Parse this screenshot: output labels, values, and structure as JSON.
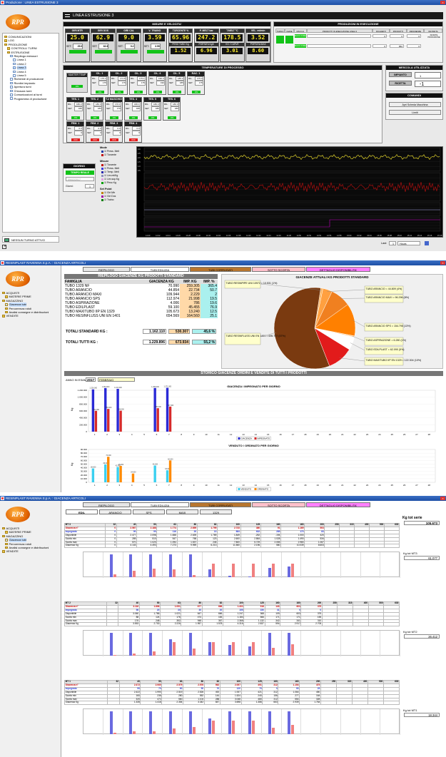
{
  "colors": {
    "accent": "#e06000",
    "seg_text": "#ffef2e",
    "ok": "#12c318",
    "alarm": "#e21b1b",
    "pie_brown": "#7a3a10"
  },
  "win1": {
    "title": "Produzione : LINEA ESTRUSIONE 3",
    "logo": "RPR",
    "header_title": "LINEA ESTRUSIONE 3",
    "tree": [
      "COMUNICAZIONI",
      "LOG",
      "PRODUZIONE",
      "CONTROLLI TURNI",
      "ESTRUSIONE",
      "Riepilogo estrusori",
      "Linea 1",
      "Linea 2",
      "Linea 3",
      "Linea 4",
      "Linea 5",
      "Richieste di produzione",
      "Riordini impianto",
      "Apertura turni",
      "Chiusura turni",
      "Comunicazioni ai turni",
      "Programma di produzione"
    ],
    "status_button": "NESSUN TURNO ATTIVO",
    "measures": {
      "title": "MISURE E VELOCITA'",
      "items": [
        {
          "label": "GIRI MTR",
          "value": "25.0",
          "set": "25.0"
        },
        {
          "label": "GIRI DOS",
          "value": "62.9",
          "set": "62.6"
        },
        {
          "label": "GIRI CAL",
          "value": "9.0",
          "set": "9.2"
        },
        {
          "label": "V. TRAINO",
          "value": "3.59",
          "set": "3.59"
        },
        {
          "label": "TORCENTE %",
          "value": "65.96",
          "extra": "PESO TUBO Kg",
          "extra_val": "1.52"
        },
        {
          "label": "P. MELT bar",
          "value": "247.2",
          "extra": "PORTATA Kg/h",
          "extra_val": "6.96"
        },
        {
          "label": "T.MELT °C",
          "value": "178.5",
          "extra": "KG / CURVE",
          "extra_val": "3.01"
        },
        {
          "label": "VEL. mt/min",
          "value": "3.52",
          "extra": "PORTATA MAX",
          "extra_val": "8.60"
        }
      ],
      "set_label": "SET:"
    },
    "production": {
      "title": "PRODUZIONI IN ESECUZIONE",
      "headers": [
        "TURNO",
        "FERIE",
        "MACCH.",
        "PRODOTTI IN ESECUZIONE LINEA 3",
        "RICHIESTI",
        "PRODOTTI",
        "RIMANENZE",
        "INFISSITA"
      ],
      "rows": [
        {
          "code": "MACC.3 DRE",
          "req": "0",
          "prod": "0",
          "rem": "0",
          "inf": "INFINITE PRODUZIONE"
        },
        {
          "code": "MACC.3 DRE",
          "req": "0",
          "prod": "862",
          "rem": "0",
          "inf": ""
        }
      ]
    },
    "temps": {
      "title": "TEMPERATURE DI PROCESSO",
      "master": "MASTER TEMP",
      "zones": [
        {
          "name": "CIL. 1",
          "ril": "175.4",
          "set": "175"
        },
        {
          "name": "CIL. 2",
          "ril": "174.8",
          "set": "175"
        },
        {
          "name": "CIL. 3",
          "ril": "175.1",
          "set": "175"
        },
        {
          "name": "CIL. 4",
          "ril": "190.3",
          "set": "190"
        },
        {
          "name": "CIL. 5",
          "ril": "185.2",
          "set": "185"
        },
        {
          "name": "RAC. 1",
          "ril": "175.0",
          "set": "175"
        },
        {
          "name": "TES. 1",
          "ril": "180.2",
          "set": "180"
        },
        {
          "name": "TES. 2",
          "ril": "180.0",
          "set": "180"
        },
        {
          "name": "T.2 MASCHIO",
          "ril": "170.1",
          "set": "170"
        },
        {
          "name": "TES. 4",
          "ril": "180.1",
          "set": "180"
        },
        {
          "name": "TES. 5",
          "ril": "180.4",
          "set": "180"
        },
        {
          "name": "TES. 6",
          "ril": "180.0",
          "set": "180"
        },
        {
          "name": "FEM. 1",
          "ril": "0.0",
          "set": "0"
        },
        {
          "name": "FEM. 2",
          "ril": "0.0",
          "set": "0"
        },
        {
          "name": "FEM. 3",
          "ril": "0.0",
          "set": "0"
        },
        {
          "name": "FEM. 4",
          "ril": "0.0",
          "set": "0"
        }
      ],
      "ril_label": "RIL.",
      "set_label": "SET",
      "on": "ON",
      "off": "OFF"
    },
    "mix": {
      "title": "MESCOLA UTILIZZATA",
      "rows": [
        {
          "label": "IMPIANTO",
          "val": "1"
        },
        {
          "label": "RICETTA",
          "val": "-1"
        }
      ]
    },
    "commands": {
      "title": "COMANDI",
      "buttons": [
        "Apri Scheda Macchina",
        "Limiti"
      ]
    },
    "day": {
      "title": "GIORNO",
      "realtime": "TEMPO REALE",
      "date": "09/02/2017",
      "shifts_label": "Giorni:",
      "shifts": "1"
    },
    "legend": {
      "modes": "Mode",
      "modes_items": [
        "Press. Melt",
        "Torcente"
      ],
      "measures": "Misure",
      "measures_items": [
        "Torcente",
        "Press. Melt",
        "Temp. Melt",
        "Lim.mt/Kg",
        "Lim.sup.Kg",
        "Peso Kg"
      ],
      "setpoint": "Set Point",
      "setpoint_items": [
        "Giri Mtr",
        "Giri Dos",
        "Traino"
      ]
    },
    "trend": {
      "ylabels_top": [
        "3.0",
        "2.5",
        "2.0",
        "1.5",
        "1.0",
        "0.5"
      ],
      "xlabels": [
        "14:20",
        "14:22",
        "14:24",
        "14:26",
        "14:28",
        "14:30",
        "14:32",
        "14:34",
        "14:36",
        "14:38",
        "14:40",
        "14:42",
        "14:44",
        "14:46",
        "14:48",
        "14:50",
        "14:52",
        "14:54",
        "14:56",
        "14:58",
        "15:00",
        "15:02",
        "15:04",
        "15:06",
        "15:08",
        "15:10",
        "15:12",
        "15:14",
        "15:16",
        "15:18"
      ],
      "last_label": "Last:",
      "last_val": "1",
      "last_unit": "Hours"
    }
  },
  "win2": {
    "title": "RESINPLAST RAVENNA S.p.A. : GIACENZA ARTICOLI",
    "logo": "RPR",
    "tree": [
      "ACQUISTI",
      "MATERIE PRIME",
      "MAGAZZINO",
      "Giacenza tubi",
      "Percorrenza rotoli",
      "Analisi consegne e distribuzioni",
      "VENDITE"
    ],
    "tabs": [
      "RIEPILOGO",
      "TUBI EDILIZIA",
      "TUBI CORRUGATI",
      "SOTTO SCORTA",
      "DETTAGLIO DISPONIBILITA'"
    ],
    "summary": {
      "title": "RIEPILOGO GIACENZE KG PRODOTTI STANDARD",
      "headers": [
        "FAMIGLIA",
        "GIACENZA KG",
        "IMP. KG",
        "IMP. %"
      ],
      "rows": [
        [
          "TUBO 1329 NF",
          "70.990",
          "259.305",
          "365.4"
        ],
        [
          "TUBO ARANCIO",
          "44.854",
          "22.734",
          "50.7"
        ],
        [
          "TUBO ARANCIO MAXI",
          "109.944",
          "2.229",
          "2"
        ],
        [
          "TUBO ARANCIO SPS",
          "112.974",
          "21.998",
          "19.5"
        ],
        [
          "TUBO ASPIRAZIONE",
          "4.006",
          "786",
          "19.6"
        ],
        [
          "TUBO EDILPLAST",
          "59.100",
          "45.455",
          "76.9"
        ],
        [
          "TUBO MAXITUBO IIP EN 1329",
          "105.673",
          "13.240",
          "12.5"
        ],
        [
          "TUBO RESINFLUSS UNI EN 1401",
          "654.569",
          "164.560",
          "25.1"
        ]
      ],
      "total_std_label": "TOTALI STANDARD KG :",
      "total_std": [
        "1.162.110",
        "530.307",
        "45,6 %"
      ],
      "total_all_label": "TOTALI TUTTI KG :",
      "total_all": [
        "1.229.896",
        "673.934",
        "55,2 %"
      ]
    },
    "pie_title": "GIACENZE ATTUALI KG PRODOTTI STANDARD",
    "pie_labels": [
      "TUBO RESINPIPE UNI 10972 = 10.531 (1%)",
      "TUBO ARANCIO = 44.809 (4%)",
      "TUBO ARANCIO MAXI = 96.296 (8%)",
      "TUBO ARANCIO SPS = 154.795 (13%)",
      "TUBO ASPIRAZIONE = 6.280 (1%)",
      "TUBO EDILPLAST = 62.090 (5%)",
      "TUBO MAXITUBO IIP EN 1329 = 122.304 (10%)",
      "TUBO RESINFLUSS UNI EN 1401 = 695.767 (57%)"
    ],
    "history": {
      "title": "STORICO GIACENZE ORDINI E VENDITE DI TUTTI I PRODOTTI",
      "year_label": "ANNO IN ESAME",
      "year": "2017",
      "month": "FEBBRAIO"
    }
  },
  "win3": {
    "title": "RESINPLAST RAVENNA S.p.A. : GIACENZA ARTICOLI",
    "logo": "RPR",
    "tree": [
      "ACQUISTI",
      "MATERIE PRIME",
      "MAGAZZINO",
      "Giacenza tubi",
      "Percorrenza rotoli",
      "Analisi consegne e distribuzioni",
      "VENDITE"
    ],
    "tabs": [
      "RIEPILOGO",
      "TUBI EDILIZIA",
      "TUBI CORRUGATI",
      "SOTTO SCORTA",
      "DETTAGLIO DISPONIBILITA'"
    ],
    "subtabs": [
      "EDIL",
      "ARANCIO",
      "SPS",
      "MAXI",
      "1329"
    ],
    "kg_tot_label": "Kg tot serie",
    "kg_tot": "105.673",
    "grids": [
      {
        "title": "MT 3",
        "diam": [
          "32",
          "40",
          "50",
          "63",
          "80",
          "82",
          "100",
          "125",
          "160",
          "160",
          "200",
          "250",
          "315",
          "400",
          "500",
          "630"
        ],
        "rows": [
          [
            "Giacenza n°",
            "0",
            "2.567",
            "2.188",
            "1.774",
            "2.659",
            "1.799",
            "2.733",
            "380",
            "91",
            "1.169",
            "503"
          ],
          [
            "Impegnato",
            "0",
            "90",
            "90",
            "116",
            "20",
            "10",
            "884",
            "632",
            "285",
            "170",
            "83"
          ],
          [
            "Disponibile",
            "0",
            "2.477",
            "2.098",
            "1.658",
            "2.639",
            "1.789",
            "1.849",
            "-252",
            "-194",
            "1.000",
            "420"
          ],
          [
            "Scorta min",
            "0",
            "285",
            "510",
            "547",
            "768",
            "123",
            "2.600",
            "2.864",
            "1.028",
            "1.490",
            "534"
          ],
          [
            "Scorta max",
            "0",
            "570",
            "1.020",
            "1.094",
            "1.537",
            "245",
            "7.800",
            "5.729",
            "2.055",
            "2.980",
            "1.067"
          ],
          [
            "Giacenza Kg",
            "0",
            "4.143",
            "4.493",
            "7.273",
            "9.959",
            "6.213",
            "11.560",
            "2.196",
            "580",
            "10.039",
            "8.603"
          ]
        ],
        "kg_label": "Kg tot MT3",
        "kg": "61.077"
      },
      {
        "title": "MT 2",
        "diam": [
          "32",
          "40",
          "50",
          "63",
          "80",
          "82",
          "100",
          "125",
          "160",
          "160",
          "200",
          "250",
          "315",
          "400",
          "500",
          "630"
        ],
        "rows": [
          [
            "Giacenza n°",
            "",
            "3.116",
            "1.806",
            "1.051",
            "677",
            "686",
            "1.402",
            "518",
            "140",
            "603",
            "375"
          ],
          [
            "Impegnato",
            "",
            "56",
            "20",
            "30",
            "30",
            "20",
            "155",
            "150",
            "31",
            "0",
            "0"
          ],
          [
            "Disponibile",
            "",
            "3.060",
            "1.786",
            "1.021",
            "647",
            "666",
            "1.247",
            "368",
            "109",
            "603",
            "375"
          ],
          [
            "Scorta min",
            "",
            "88",
            "124",
            "176",
            "474",
            "183",
            "1.184",
            "566",
            "171",
            "171",
            "155"
          ],
          [
            "Scorta max",
            "",
            "176",
            "248",
            "352",
            "948",
            "367",
            "2.368",
            "1.132",
            "342",
            "341",
            "310"
          ],
          [
            "Giacenza Kg",
            "",
            "3.553",
            "2.730",
            "2.226",
            "1.957",
            "1.578",
            "4.316",
            "2.837",
            "594",
            "2.917",
            "2.705"
          ]
        ],
        "kg_label": "Kg tot MT2",
        "kg": "26.412"
      },
      {
        "title": "MT 1",
        "diam": [
          "32",
          "40",
          "50",
          "63",
          "80",
          "82",
          "100",
          "125",
          "160",
          "160",
          "200",
          "250",
          "315",
          "400",
          "500",
          "630"
        ],
        "rows": [
          [
            "Giacenza n°",
            "",
            "2.472",
            "2.060",
            "2.579",
            "2.576",
            "562",
            "2.057",
            "491",
            "312",
            "1.154",
            "475"
          ],
          [
            "Impegnato",
            "",
            "50",
            "70",
            "60",
            "50",
            "70",
            "120",
            "70",
            "0",
            "90",
            "25"
          ],
          [
            "Disponibile",
            "",
            "2.422",
            "1.990",
            "2.519",
            "2.526",
            "492",
            "1.937",
            "421",
            "312",
            "1.064",
            "450"
          ],
          [
            "Scorta min",
            "",
            "160",
            "236",
            "280",
            "552",
            "144",
            "1.524",
            "240",
            "156",
            "277",
            "164"
          ],
          [
            "Scorta max",
            "",
            "320",
            "472",
            "560",
            "1.104",
            "288",
            "3.048",
            "480",
            "312",
            "554",
            "328"
          ],
          [
            "Giacenza Kg",
            "",
            "1.335",
            "1.418",
            "2.354",
            "3.342",
            "847",
            "3.698",
            "1.386",
            "663",
            "2.939",
            "1.764"
          ]
        ],
        "kg_label": "Kg tot MT1",
        "kg": "18.344"
      }
    ]
  },
  "chart_data": [
    {
      "type": "bar",
      "title": "GIACENZA / IMPEGNATO PER GIORNO",
      "categories": [
        "1",
        "2",
        "3",
        "4",
        "5",
        "6",
        "7",
        "8",
        "9",
        "10",
        "11",
        "12",
        "13",
        "14",
        "15",
        "16",
        "17",
        "18",
        "19",
        "20",
        "21",
        "22",
        "23",
        "24",
        "25",
        "26",
        "27",
        "28"
      ],
      "series": [
        {
          "name": "GIACENZA",
          "values": [
            1226000,
            1264000,
            1241000,
            0,
            0,
            1266000,
            1271000,
            0,
            0,
            0,
            0,
            0,
            0,
            0,
            0,
            0,
            0,
            0,
            0,
            0,
            0,
            0,
            0,
            0,
            0,
            0,
            0,
            0
          ]
        },
        {
          "name": "IMPEGNATO",
          "values": [
            604000,
            659000,
            608000,
            0,
            0,
            680000,
            727000,
            0,
            0,
            0,
            0,
            0,
            0,
            0,
            0,
            0,
            0,
            0,
            0,
            0,
            0,
            0,
            0,
            0,
            0,
            0,
            0,
            0
          ]
        }
      ],
      "ylabel": "Kg",
      "ylim": [
        0,
        1400000
      ],
      "yticks": [
        "1.200.000",
        "1.000.000",
        "800.000",
        "600.000",
        "400.000",
        "200.000",
        "0"
      ],
      "legend": "bottom"
    },
    {
      "type": "bar",
      "title": "VENDUTO / ORDINATO PER GIORNO",
      "categories": [
        "1",
        "2",
        "3",
        "4",
        "5",
        "6",
        "7",
        "8",
        "9",
        "10",
        "11",
        "12",
        "13",
        "14",
        "15",
        "16",
        "17",
        "18",
        "19",
        "20",
        "21",
        "22",
        "23",
        "24",
        "25",
        "26",
        "27",
        "28"
      ],
      "series": [
        {
          "name": "VENDUTO",
          "values": [
            38000,
            49000,
            42000,
            0,
            0,
            46000,
            33000,
            0,
            0,
            0,
            0,
            0,
            0,
            0,
            0,
            0,
            0,
            0,
            0,
            0,
            0,
            0,
            0,
            0,
            0,
            0,
            0,
            0
          ]
        },
        {
          "name": "ORDINATO",
          "values": [
            0,
            70000,
            45000,
            24000,
            0,
            0,
            60000,
            0,
            0,
            0,
            0,
            0,
            0,
            0,
            0,
            0,
            0,
            0,
            0,
            0,
            0,
            0,
            0,
            0,
            0,
            0,
            0,
            0
          ]
        }
      ],
      "ylabel": "Kg",
      "ylim": [
        0,
        100000
      ],
      "yticks": [
        "90.000",
        "80.000",
        "70.000",
        "60.000",
        "50.000",
        "40.000",
        "30.000",
        "20.000",
        "10.000",
        "0"
      ],
      "legend": "bottom"
    },
    {
      "type": "pie",
      "title": "GIACENZE ATTUALI KG PRODOTTI STANDARD",
      "categories": [
        "TUBO RESINPIPE UNI 10972",
        "TUBO ARANCIO",
        "TUBO ARANCIO MAXI",
        "TUBO ARANCIO SPS",
        "TUBO ASPIRAZIONE",
        "TUBO EDILPLAST",
        "TUBO MAXITUBO IIP EN 1329",
        "TUBO RESINFLUSS UNI EN 1401"
      ],
      "values": [
        10531,
        44809,
        96296,
        154795,
        6280,
        62090,
        122304,
        695767
      ],
      "colors": [
        "#ffb35c",
        "#ffa040",
        "#f08020",
        "#ff8000",
        "#ffcc99",
        "#ffffff",
        "#e21b1b",
        "#7a3a10"
      ]
    }
  ]
}
